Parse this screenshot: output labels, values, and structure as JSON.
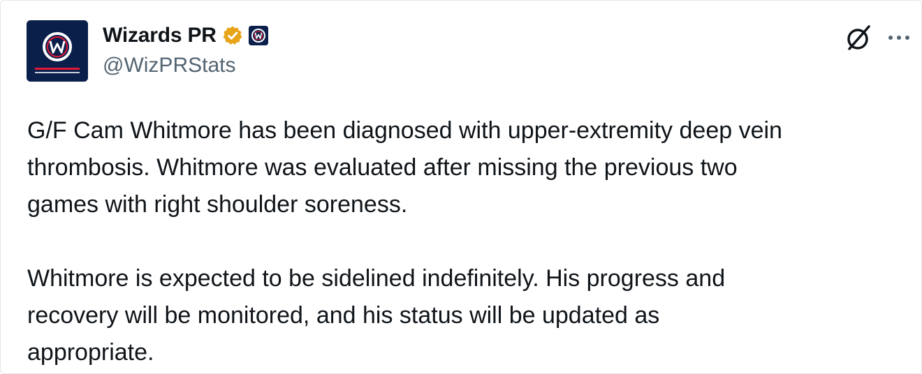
{
  "author": {
    "display_name": "Wizards PR",
    "handle": "@WizPRStats",
    "verified_badge": "verified-gold-badge",
    "affiliation_icon": "wizards-logo",
    "colors": {
      "navy": "#0b1f4b",
      "red": "#e31837",
      "gold": "#e8a317"
    }
  },
  "actions": {
    "grok_icon": "grok-icon",
    "more_icon": "more-options-icon"
  },
  "tweet": {
    "paragraph_1": "G/F Cam Whitmore has been diagnosed with upper-extremity deep vein\nthrombosis. Whitmore was evaluated after missing the previous two\ngames with right shoulder soreness.",
    "paragraph_2": "Whitmore is expected to be sidelined indefinitely. His progress and\nrecovery will be monitored, and his status will be updated as\nappropriate."
  }
}
